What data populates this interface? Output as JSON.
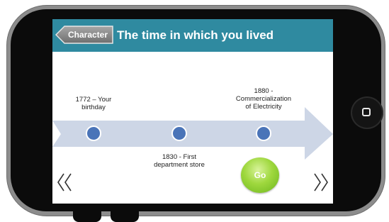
{
  "header": {
    "back_label": "Character",
    "title": "The time in which you lived"
  },
  "timeline": {
    "events": [
      {
        "label": "1772 – Your\nbirthday"
      },
      {
        "label": "1830 - First\ndepartment store"
      },
      {
        "label": "1880 -\nCommercialization\nof Electricity"
      }
    ]
  },
  "controls": {
    "go_label": "Go",
    "prev_icon": "double-chevron-left-icon",
    "next_icon": "double-chevron-right-icon"
  },
  "colors": {
    "header": "#2f8aa0",
    "arrow": "#cdd6e6",
    "dot": "#4a74b8",
    "go": "#8fcd32"
  }
}
